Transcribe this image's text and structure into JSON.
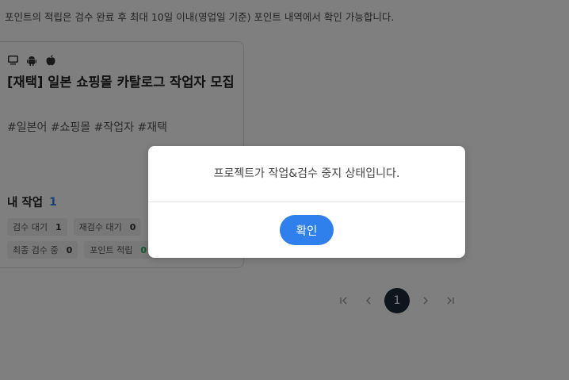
{
  "notice": "포인트의 적립은 검수 완료 후 최대 10일 이내(영업일 기준) 포인트 내역에서 확인 가능합니다.",
  "card": {
    "platform_icons": [
      "desktop-icon",
      "android-icon",
      "apple-icon"
    ],
    "title": "[재택] 일본 쇼핑몰 카탈로그 작업자 모집",
    "tags": "#일본어 #쇼핑몰 #작업자 #재택",
    "my_work": {
      "label": "내 작업",
      "count": "1"
    },
    "status_row1": [
      {
        "label": "검수 대기",
        "value": "1"
      },
      {
        "label": "재검수 대기",
        "value": "0"
      }
    ],
    "status_row2": [
      {
        "label": "최종 검수 중",
        "value": "0"
      },
      {
        "label": "포인트 적립",
        "value": "0"
      }
    ]
  },
  "pagination": {
    "first": "|<",
    "prev": "<",
    "current": "1",
    "next": ">",
    "last": ">|"
  },
  "modal": {
    "message": "프로젝트가 작업&검수 중지 상태입니다.",
    "confirm_label": "확인",
    "accent_color": "#2f80ed"
  }
}
